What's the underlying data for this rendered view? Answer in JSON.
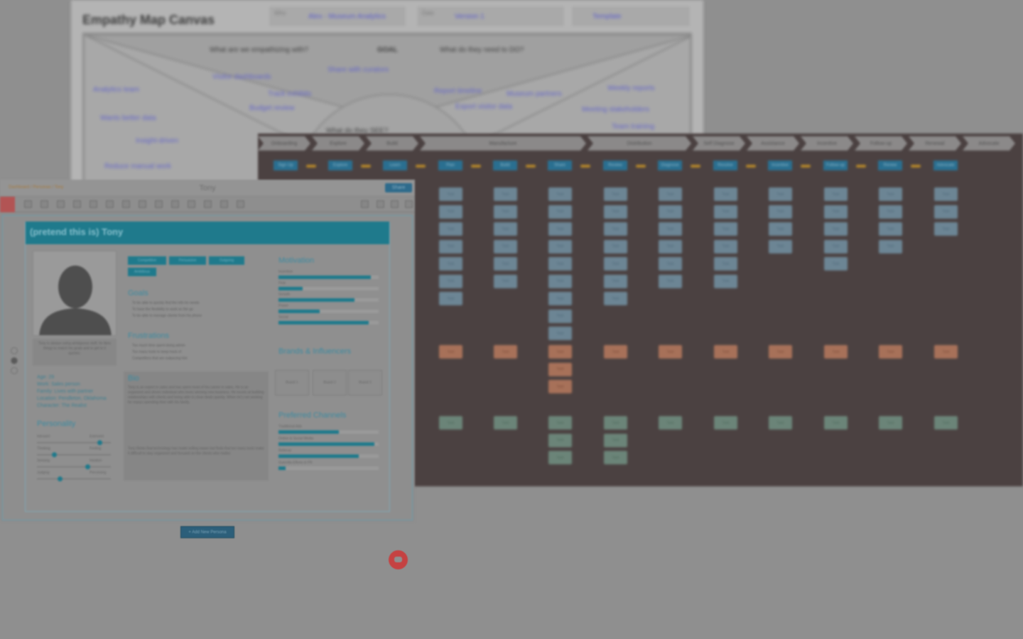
{
  "empathy_map": {
    "title": "Empathy Map Canvas",
    "fields": [
      {
        "label": "Who",
        "value": "Alex - Museum Analytics"
      },
      {
        "label": "Date",
        "value": "Version 1"
      },
      {
        "label": "",
        "value": "Template"
      }
    ],
    "questions": [
      "What are we empathizing with?",
      "What do they need to DO?",
      "What do they SEE?"
    ],
    "goal_label": "GOAL",
    "stickies": [
      "Analytics team",
      "Wants better data",
      "Insight-driven",
      "Reduce manual work",
      "Visitor dashboards",
      "Track exhibits",
      "Budget review",
      "Share with curators",
      "Report timeline",
      "Museum partners",
      "Export visitor data",
      "Weekly reports",
      "Meeting stakeholders",
      "Team training"
    ]
  },
  "journey_map": {
    "phases": [
      "Onboarding",
      "Explore",
      "Build",
      "Manufacture",
      "Distribution",
      "Self Diagnose",
      "Assistance",
      "Incentive",
      "Follow-up",
      "Renewal",
      "Advocate"
    ],
    "steps": [
      "Sign Up",
      "Explore",
      "Learn",
      "Plan",
      "Build",
      "Share",
      "Review",
      "Diagnose",
      "Resolve",
      "Incentive",
      "Follow-up",
      "Renew",
      "Advocate"
    ],
    "card_label": "Task"
  },
  "persona_editor": {
    "breadcrumb": "Dashboard / Personas / Tony",
    "doc_title": "Tony",
    "share_label": "Share",
    "header": "(pretend this is) Tony",
    "quote": "Tony is always using ambiguous stuff, he likes things to match his goals and to get to it quicker.",
    "info": [
      "Age: 29",
      "Work: Sales person",
      "Family: Lives with partner",
      "Location: Pendleton, Oklahoma",
      "Character: The Realist"
    ],
    "tags": [
      "Competitive",
      "Persuasive",
      "Outgoing",
      "Ambitious"
    ],
    "sections": {
      "goals": "Goals",
      "frustrations": "Frustrations",
      "bio": "Bio",
      "motivation": "Motivation",
      "brands": "Brands & Influencers",
      "channels": "Preferred Channels",
      "personality": "Personality"
    },
    "goals": [
      "To be able to quickly find the info he needs",
      "To have the flexibility to work on the go",
      "To be able to manage clients from his phone"
    ],
    "frustrations": [
      "Too much time spent doing admin",
      "Too many tools to keep track of",
      "Competitors that are outpacing him"
    ],
    "bio": [
      "Tony is an expert in sales and has spent most of his career in sales. He is an organized and driven individual who loves winning new business. He excels at building relationships with clients and being able to close deals quickly. When he's not working he enjoys spending time with his family.",
      "Tony thinks that technology has made selling easier but finds that too many tools make it difficult to stay organized and focused on the clients who matter."
    ],
    "motivation": [
      {
        "label": "Incentive",
        "value": 0.92
      },
      {
        "label": "Fear",
        "value": 0.24
      },
      {
        "label": "Growth",
        "value": 0.76
      },
      {
        "label": "Power",
        "value": 0.41
      },
      {
        "label": "Social",
        "value": 0.9
      }
    ],
    "channels": [
      {
        "label": "Traditional Ads",
        "value": 0.6
      },
      {
        "label": "Online & Social Media",
        "value": 0.96
      },
      {
        "label": "Referral",
        "value": 0.8
      },
      {
        "label": "Guerrilla Efforts & PR",
        "value": 0.07
      }
    ],
    "personality": [
      {
        "left": "Introvert",
        "right": "Extrovert",
        "value": 0.82
      },
      {
        "left": "Thinking",
        "right": "Feeling",
        "value": 0.2
      },
      {
        "left": "Sensing",
        "right": "Intuition",
        "value": 0.65
      },
      {
        "left": "Judging",
        "right": "Perceiving",
        "value": 0.28
      }
    ],
    "brand_names": [
      "Brand 1",
      "Brand 2",
      "Brand 3"
    ]
  },
  "add_persona_label": "+ Add New Persona"
}
